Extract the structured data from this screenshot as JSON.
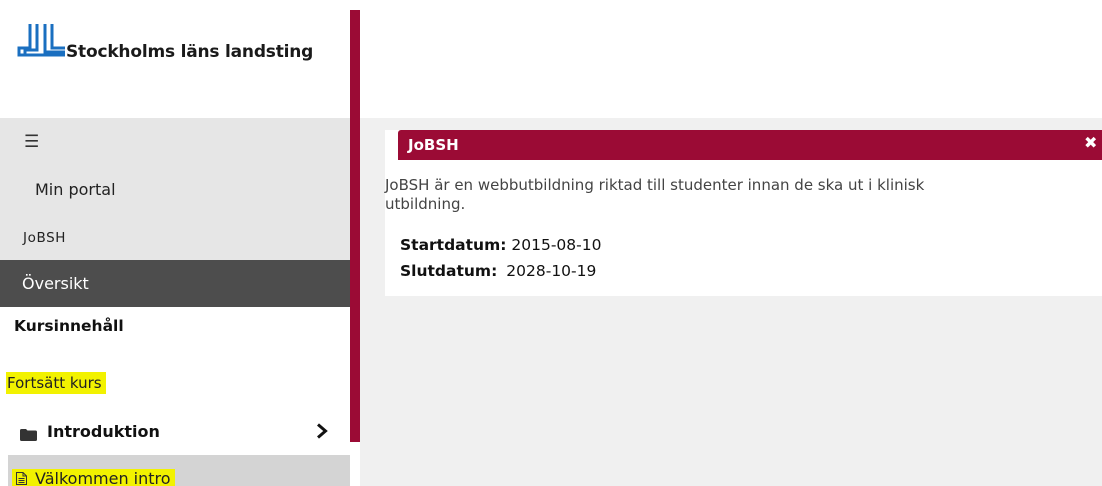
{
  "brand": {
    "name": "Stockholms läns landsting",
    "color": "#1a6fc0"
  },
  "nav": {
    "menu_icon": "hamburger-icon",
    "min_portal": "Min portal",
    "course_code": "JoBSH",
    "overview": "Översikt"
  },
  "course_nav": {
    "heading": "Kursinnehåll",
    "continue": "Fortsätt kurs",
    "section": {
      "label": "Introduktion",
      "icon": "folder-icon",
      "expand_icon": "chevron-right-icon"
    },
    "item": {
      "label": "Välkommen intro",
      "icon": "document-icon"
    }
  },
  "card": {
    "title": "JoBSH",
    "close_icon": "close-icon",
    "description": "JoBSH är en webbutbildning riktad till studenter innan de ska ut i klinisk utbildning.",
    "start_label": "Startdatum:",
    "start_value": "2015-08-10",
    "end_label": "Slutdatum:",
    "end_value": "2028-10-19"
  },
  "colors": {
    "accent": "#9b0b35",
    "highlight": "#f2f200",
    "active_nav": "#4d4d4d"
  }
}
